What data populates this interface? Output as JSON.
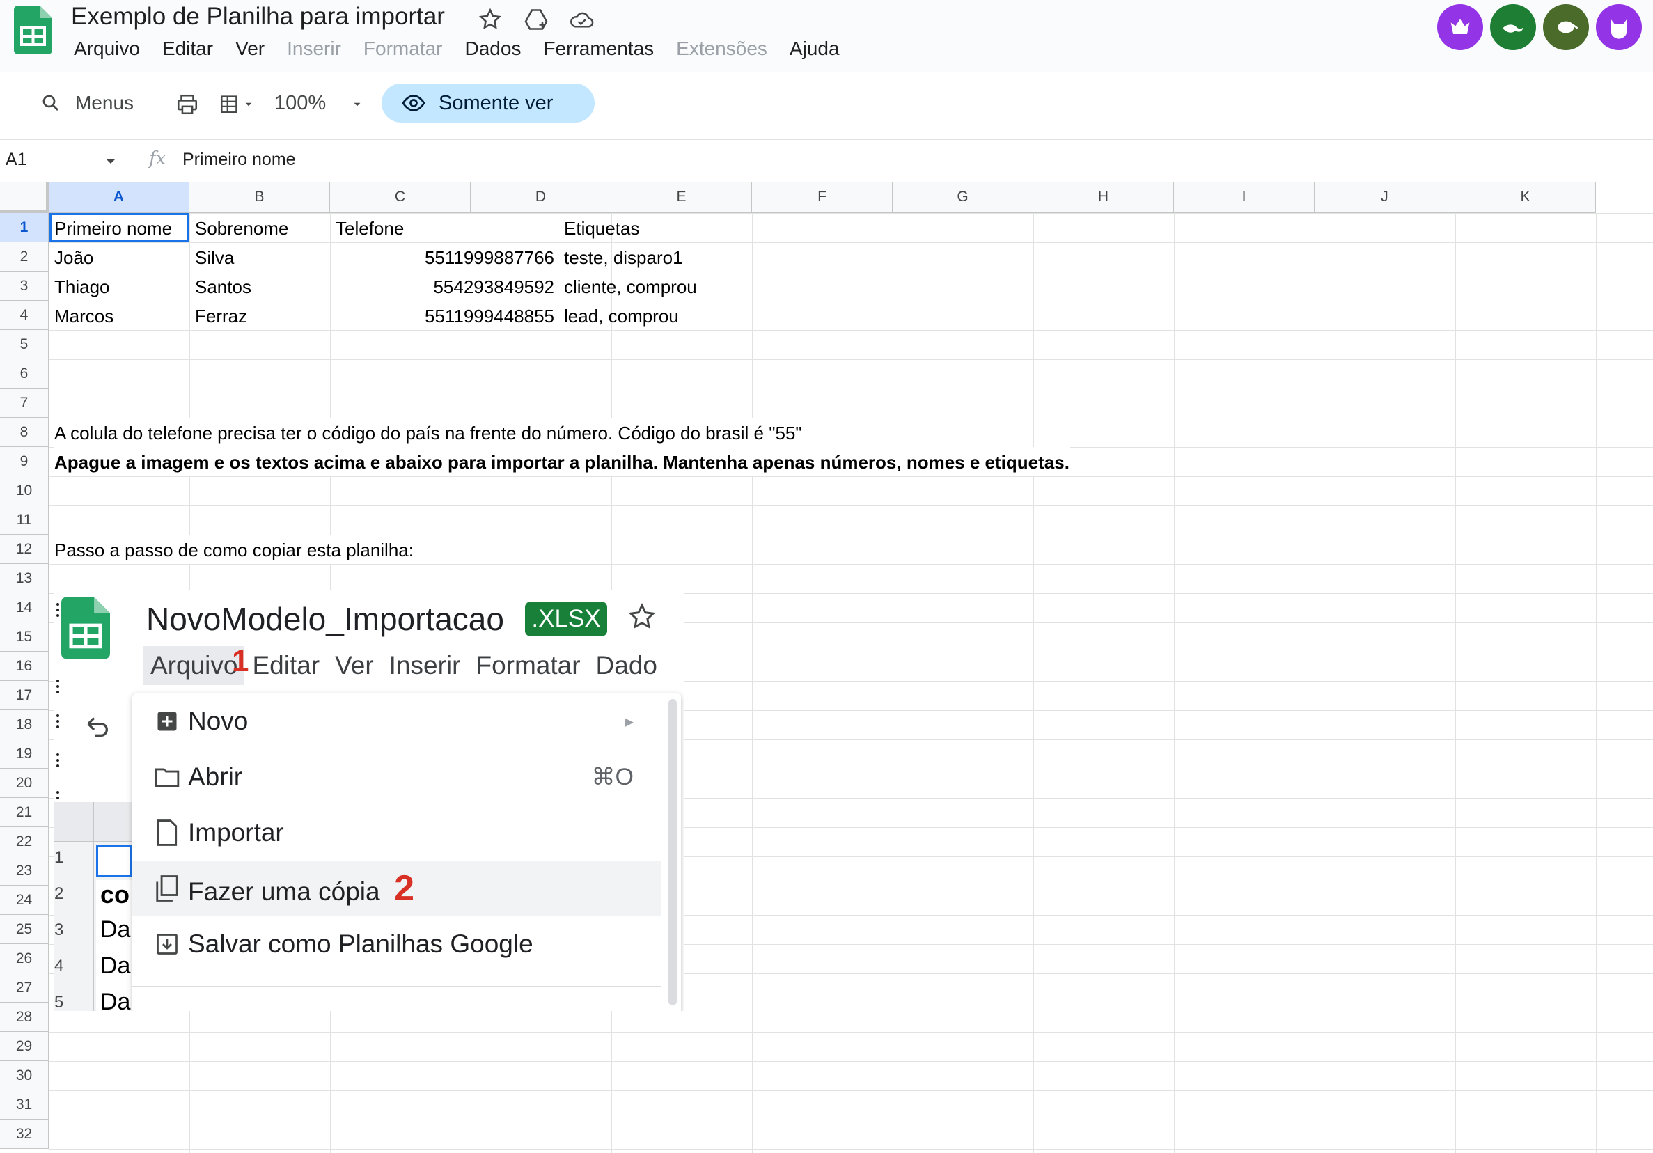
{
  "app": {
    "doc_title": "Exemplo de Planilha para importar",
    "menu": [
      {
        "label": "Arquivo",
        "disabled": false
      },
      {
        "label": "Editar",
        "disabled": false
      },
      {
        "label": "Ver",
        "disabled": false
      },
      {
        "label": "Inserir",
        "disabled": true
      },
      {
        "label": "Formatar",
        "disabled": true
      },
      {
        "label": "Dados",
        "disabled": false
      },
      {
        "label": "Ferramentas",
        "disabled": false
      },
      {
        "label": "Extensões",
        "disabled": true
      },
      {
        "label": "Ajuda",
        "disabled": false
      }
    ],
    "avatars": [
      {
        "icon": "crowned-creature-icon",
        "color": "#9334e6"
      },
      {
        "icon": "lizard-icon",
        "color": "#1e7e34"
      },
      {
        "icon": "kiwi-bird-icon",
        "color": "#4a6b2a"
      },
      {
        "icon": "cat-face-icon",
        "color": "#9334e6"
      }
    ]
  },
  "toolbar": {
    "search_label": "Menus",
    "zoom": "100%",
    "view_only_label": "Somente ver"
  },
  "formula_bar": {
    "cell_ref": "A1",
    "fx": "fx",
    "content": "Primeiro nome"
  },
  "sheet": {
    "columns": [
      "A",
      "B",
      "C",
      "D",
      "E",
      "F",
      "G",
      "H",
      "I",
      "J",
      "K"
    ],
    "rows": [
      "1",
      "2",
      "3",
      "4",
      "5",
      "6",
      "7",
      "8",
      "9",
      "10",
      "11",
      "12",
      "13",
      "14",
      "15",
      "16",
      "17",
      "18",
      "19",
      "20",
      "21",
      "22",
      "23",
      "24",
      "25",
      "26",
      "27",
      "28",
      "29",
      "30",
      "31",
      "32"
    ],
    "cells": {
      "A1": "Primeiro nome",
      "B1": "Sobrenome",
      "C1": "Telefone",
      "D1": "Etiquetas",
      "A2": "João",
      "B2": "Silva",
      "C2": "5511999887766",
      "D2": "teste, disparo1",
      "A3": "Thiago",
      "B3": "Santos",
      "C3": "554293849592",
      "D3": "cliente, comprou",
      "A4": "Marcos",
      "B4": "Ferraz",
      "C4": "5511999448855",
      "D4": "lead, comprou",
      "A8": "A colula do telefone precisa ter o código do país na frente do número. Código do brasil é \"55\"",
      "A9": "Apague a imagem e os textos acima e abaixo para importar a planilha. Mantenha apenas números, nomes e etiquetas.",
      "A12": "Passo a passo de como copiar esta planilha:"
    }
  },
  "embedded_image": {
    "title": "NovoModelo_Importacao",
    "badge": ".XLSX",
    "menu": [
      "Arquivo",
      "Editar",
      "Ver",
      "Inserir",
      "Formatar",
      "Dado"
    ],
    "step1": "1",
    "step2": "2",
    "items": [
      {
        "label": "Novo",
        "shortcut": "▸",
        "icon": "plus-square-icon"
      },
      {
        "label": "Abrir",
        "shortcut": "⌘O",
        "icon": "folder-icon"
      },
      {
        "label": "Importar",
        "shortcut": "",
        "icon": "file-icon"
      },
      {
        "label": "Fazer uma cópia",
        "shortcut": "",
        "icon": "copy-icon"
      },
      {
        "label": "Salvar como Planilhas Google",
        "shortcut": "",
        "icon": "download-box-icon"
      }
    ],
    "bg_partial": {
      "r24": "co",
      "r25": "Da",
      "r26": "Da",
      "r27": "Da",
      "n1": "1",
      "n2": "2",
      "n3": "3",
      "n4": "4",
      "n5": "5"
    }
  }
}
